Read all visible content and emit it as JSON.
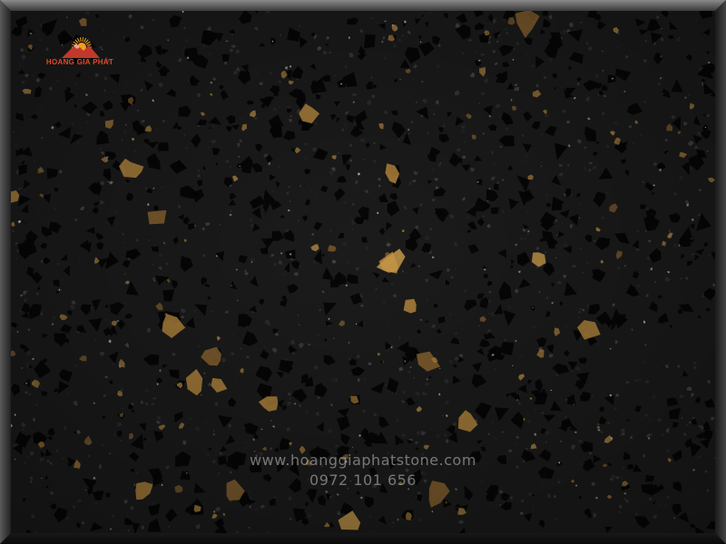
{
  "brand": {
    "name": "HOANG GIA PHÁT",
    "logo_color": "#e04a2a",
    "mountain_color": "#c0392b",
    "sun_color": "#f0a020"
  },
  "watermark": {
    "website": "www.hoanggiaphatstone.com",
    "phone": "0972 101 656"
  },
  "colors": {
    "stone_base": "#1b1b1b",
    "bevel_light": "#6a6a6a",
    "bevel_dark": "#0a0a0a",
    "fleck_gold": "#b7883d",
    "fleck_black": "#050505",
    "sparkle": "#d8d8d8"
  },
  "icons": {
    "logo": "mountain-sun-logo-icon"
  }
}
